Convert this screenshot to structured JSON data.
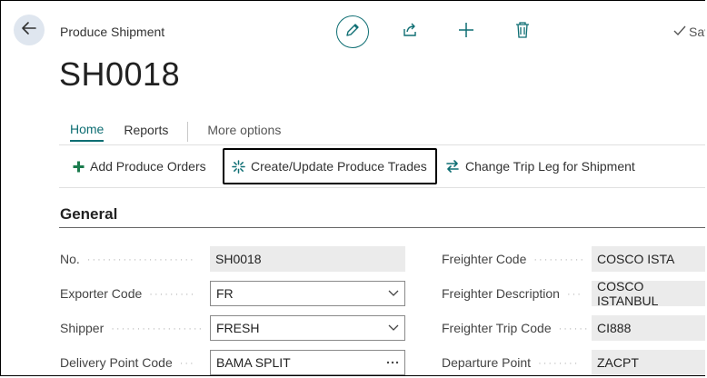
{
  "header": {
    "caption": "Produce Shipment",
    "title": "SH0018",
    "save_label": "Sav"
  },
  "icons": {
    "back": "arrow-left-icon",
    "edit": "pencil-icon",
    "share": "share-icon",
    "new": "plus-icon",
    "delete": "trash-icon",
    "save": "checkmark-icon"
  },
  "tabs": [
    {
      "label": "Home",
      "active": true
    },
    {
      "label": "Reports",
      "active": false
    },
    {
      "label": "More options",
      "active": false
    }
  ],
  "actions": [
    {
      "label": "Add Produce Orders",
      "icon": "plus-icon"
    },
    {
      "label": "Create/Update Produce Trades",
      "icon": "asterisk-icon"
    },
    {
      "label": "Change Trip Leg for Shipment",
      "icon": "swap-arrows-icon"
    }
  ],
  "section": {
    "title": "General"
  },
  "fields_left": [
    {
      "label": "No.",
      "value": "SH0018",
      "kind": "readonly"
    },
    {
      "label": "Exporter Code",
      "value": "FR",
      "kind": "dropdown"
    },
    {
      "label": "Shipper",
      "value": "FRESH",
      "kind": "dropdown"
    },
    {
      "label": "Delivery Point Code",
      "value": "BAMA SPLIT",
      "kind": "lookup"
    }
  ],
  "fields_right": [
    {
      "label": "Freighter Code",
      "value": "COSCO ISTA",
      "kind": "readonly"
    },
    {
      "label": "Freighter Description",
      "value": "COSCO ISTANBUL",
      "kind": "readonly"
    },
    {
      "label": "Freighter Trip Code",
      "value": "CI888",
      "kind": "readonly"
    },
    {
      "label": "Departure Point",
      "value": "ZACPT",
      "kind": "readonly"
    }
  ],
  "colors": {
    "accent": "#0e6e73",
    "action_plus": "#1a7b4d",
    "back_button_bg": "#dfe6ef",
    "readonly_bg": "#ebebeb"
  }
}
